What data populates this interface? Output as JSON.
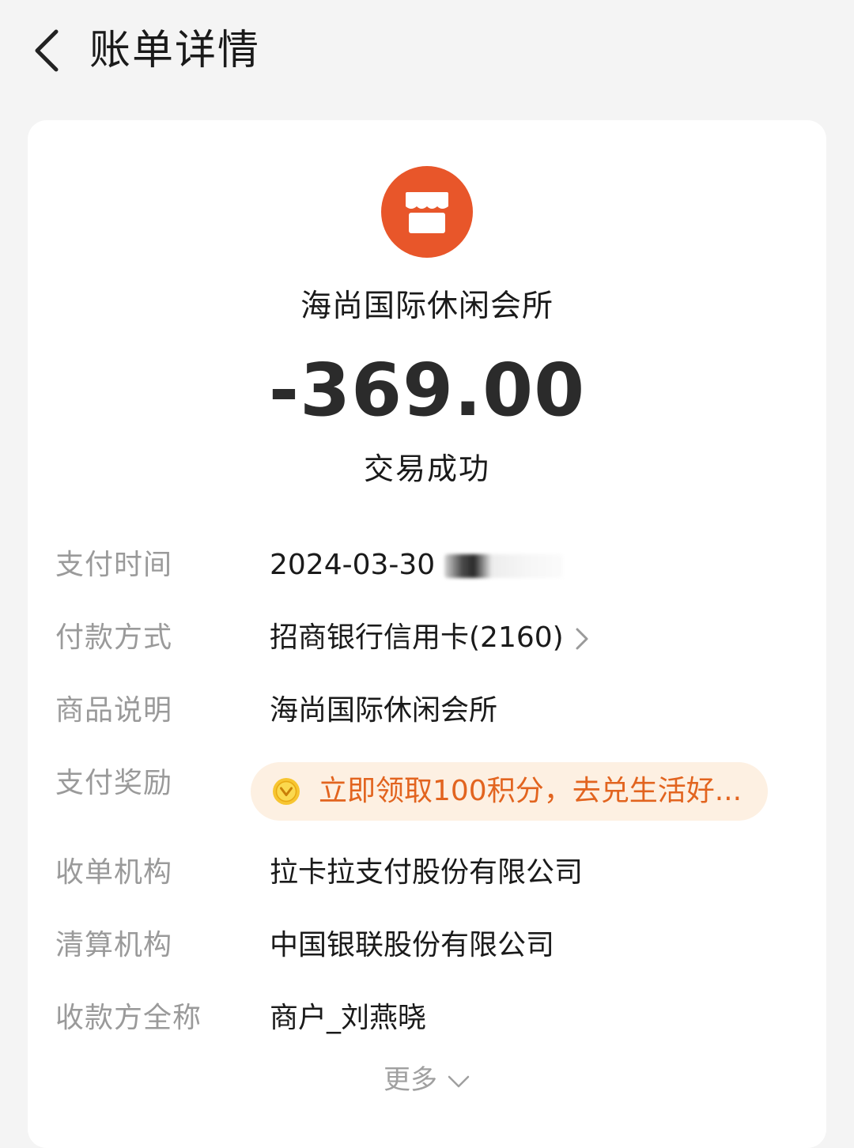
{
  "header": {
    "title": "账单详情",
    "back_icon": "chevron-left-icon"
  },
  "summary": {
    "merchant_icon": "store-icon",
    "merchant_name": "海尚国际休闲会所",
    "amount": "-369.00",
    "status": "交易成功"
  },
  "details": {
    "pay_time": {
      "label": "支付时间",
      "value": "2024-03-30"
    },
    "payment_method": {
      "label": "付款方式",
      "value": "招商银行信用卡(2160)"
    },
    "product_desc": {
      "label": "商品说明",
      "value": "海尚国际休闲会所"
    },
    "reward": {
      "label": "支付奖励",
      "value": "立即领取100积分，去兑生活好..."
    },
    "acquirer": {
      "label": "收单机构",
      "value": "拉卡拉支付股份有限公司"
    },
    "clearing": {
      "label": "清算机构",
      "value": "中国银联股份有限公司"
    },
    "payee": {
      "label": "收款方全称",
      "value": "商户_刘燕晓"
    }
  },
  "more": {
    "label": "更多"
  },
  "colors": {
    "merchant_logo_bg": "#e8562a",
    "reward_text": "#e2641f",
    "reward_bg": "#fdf0e2",
    "label_gray": "#9a9a9a"
  }
}
